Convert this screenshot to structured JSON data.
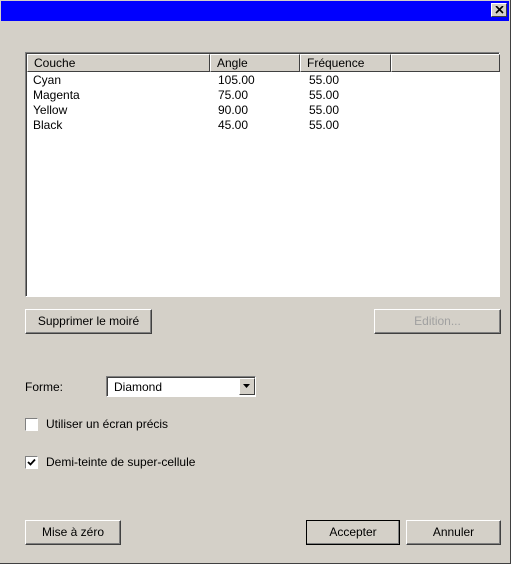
{
  "window": {
    "title": "",
    "titlebar_color": "#0000ff",
    "close_icon": "close-icon"
  },
  "list": {
    "columns": [
      "Couche",
      "Angle",
      "Fréquence"
    ],
    "rows": [
      {
        "couche": "Cyan",
        "angle": "105.00",
        "frequence": "55.00"
      },
      {
        "couche": "Magenta",
        "angle": "75.00",
        "frequence": "55.00"
      },
      {
        "couche": "Yellow",
        "angle": "90.00",
        "frequence": "55.00"
      },
      {
        "couche": "Black",
        "angle": "45.00",
        "frequence": "55.00"
      }
    ]
  },
  "buttons": {
    "remove_moire": "Supprimer le moiré",
    "edit": "Edition...",
    "reset": "Mise à zéro",
    "accept": "Accepter",
    "cancel": "Annuler"
  },
  "shape": {
    "label": "Forme:",
    "selected": "Diamond"
  },
  "options": {
    "precise_screen": {
      "label": "Utiliser un écran précis",
      "checked": false
    },
    "supercell": {
      "label": "Demi-teinte de super-cellule",
      "checked": true
    }
  }
}
